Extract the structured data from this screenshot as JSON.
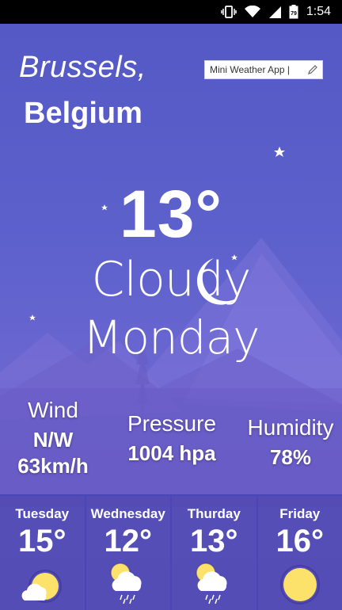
{
  "status_bar": {
    "time": "1:54",
    "battery_level": "79"
  },
  "location": {
    "city": "Brussels,",
    "country": "Belgium"
  },
  "search": {
    "value": "Mini Weather App |"
  },
  "current": {
    "temperature": "13°",
    "condition": "Cloudy",
    "day": "Monday"
  },
  "stats": {
    "wind": {
      "label": "Wind",
      "direction": "N/W",
      "speed": "63km/h"
    },
    "pressure": {
      "label": "Pressure",
      "value": "1004 hpa"
    },
    "humidity": {
      "label": "Humidity",
      "value": "78%"
    }
  },
  "forecast": [
    {
      "day": "Tuesday",
      "temp": "15°",
      "icon": "partly-sunny-icon"
    },
    {
      "day": "Wednesday",
      "temp": "12°",
      "icon": "sun-rain-icon"
    },
    {
      "day": "Thurday",
      "temp": "13°",
      "icon": "sun-rain-icon"
    },
    {
      "day": "Friday",
      "temp": "16°",
      "icon": "sun-icon"
    }
  ],
  "colors": {
    "background": "#5b63c6",
    "status_bar": "#000000",
    "sun": "#fce26a"
  }
}
